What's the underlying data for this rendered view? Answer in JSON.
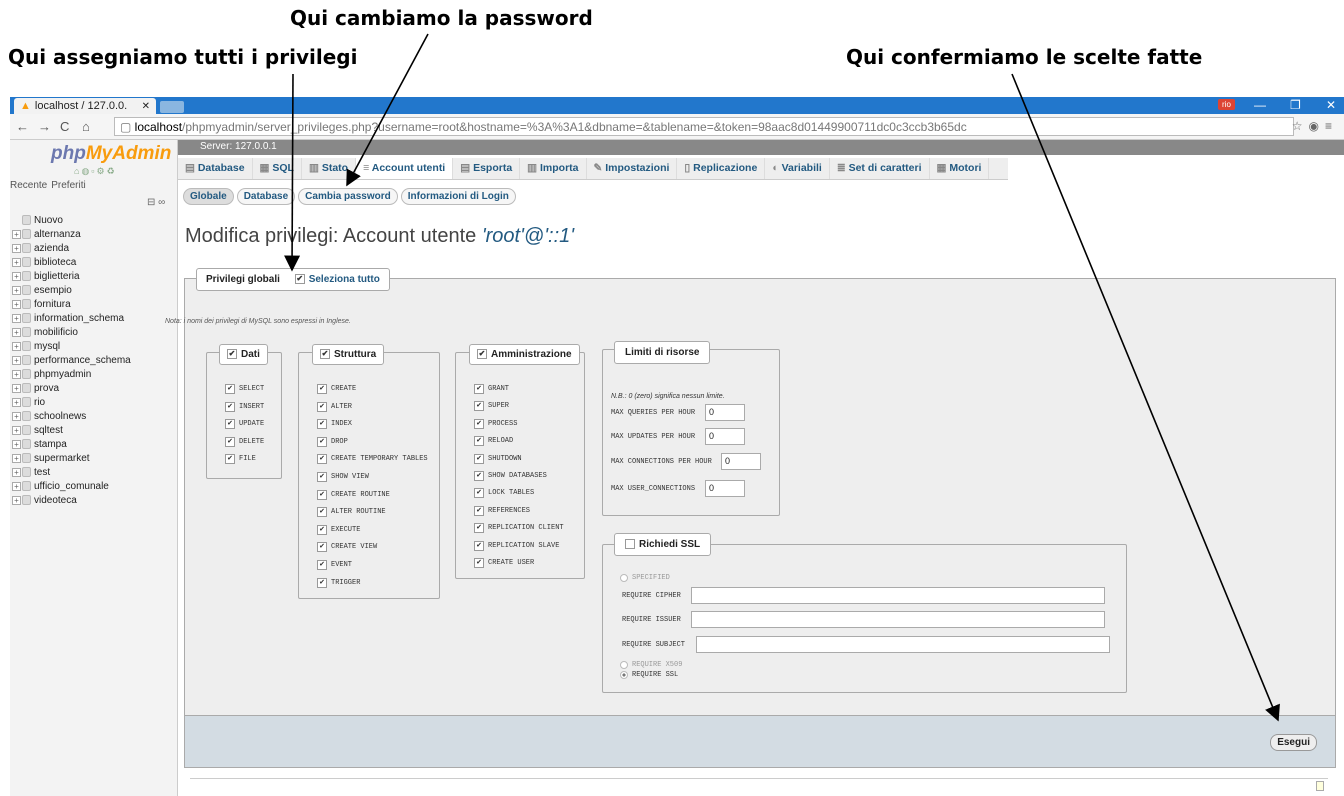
{
  "annotations": {
    "password": "Qui cambiamo la password",
    "privileges": "Qui assegniamo tutti i privilegi",
    "confirm": "Qui confermiamo le scelte fatte"
  },
  "browser": {
    "tab_title": "localhost / 127.0.0.",
    "url_host": "localhost",
    "url_rest": "/phpmyadmin/server_privileges.php?username=root&hostname=%3A%3A1&dbname=&tablename=&token=98aac8d01449900711dc0c3ccb3b65dc",
    "profile": "rio"
  },
  "sidebar": {
    "logo_a": "php",
    "logo_b": "MyAdmin",
    "recent": "Recente",
    "favorites": "Preferiti",
    "new": "Nuovo",
    "databases": [
      "alternanza",
      "azienda",
      "biblioteca",
      "biglietteria",
      "esempio",
      "fornitura",
      "information_schema",
      "mobilificio",
      "mysql",
      "performance_schema",
      "phpmyadmin",
      "prova",
      "rio",
      "schoolnews",
      "sqltest",
      "stampa",
      "supermarket",
      "test",
      "ufficio_comunale",
      "videoteca"
    ]
  },
  "server": "Server: 127.0.0.1",
  "menu": [
    "Database",
    "SQL",
    "Stato",
    "Account utenti",
    "Esporta",
    "Importa",
    "Impostazioni",
    "Replicazione",
    "Variabili",
    "Set di caratteri",
    "Motori"
  ],
  "subtabs": [
    "Globale",
    "Database",
    "Cambia password",
    "Informazioni di Login"
  ],
  "page": {
    "title": "Modifica privilegi: Account utente ",
    "user": "'root'@'::1'"
  },
  "global": {
    "legend": "Privilegi globali",
    "select_all": "Seleziona tutto"
  },
  "note": "Nota: i nomi dei privilegi di MySQL sono espressi in Inglese.",
  "groups": {
    "data": {
      "title": "Dati",
      "items": [
        "SELECT",
        "INSERT",
        "UPDATE",
        "DELETE",
        "FILE"
      ]
    },
    "structure": {
      "title": "Struttura",
      "items": [
        "CREATE",
        "ALTER",
        "INDEX",
        "DROP",
        "CREATE TEMPORARY TABLES",
        "SHOW VIEW",
        "CREATE ROUTINE",
        "ALTER ROUTINE",
        "EXECUTE",
        "CREATE VIEW",
        "EVENT",
        "TRIGGER"
      ]
    },
    "admin": {
      "title": "Amministrazione",
      "items": [
        "GRANT",
        "SUPER",
        "PROCESS",
        "RELOAD",
        "SHUTDOWN",
        "SHOW DATABASES",
        "LOCK TABLES",
        "REFERENCES",
        "REPLICATION CLIENT",
        "REPLICATION SLAVE",
        "CREATE USER"
      ]
    }
  },
  "limits": {
    "title": "Limiti di risorse",
    "note": "N.B.: 0 (zero) significa nessun limite.",
    "rows": [
      {
        "label": "MAX QUERIES PER HOUR",
        "value": "0"
      },
      {
        "label": "MAX UPDATES PER HOUR",
        "value": "0"
      },
      {
        "label": "MAX CONNECTIONS PER HOUR",
        "value": "0"
      },
      {
        "label": "MAX USER_CONNECTIONS",
        "value": "0"
      }
    ]
  },
  "ssl": {
    "title": "Richiedi SSL",
    "specified": "SPECIFIED",
    "cipher": "REQUIRE CIPHER",
    "issuer": "REQUIRE ISSUER",
    "subject": "REQUIRE SUBJECT",
    "x509": "REQUIRE X509",
    "ssl": "REQUIRE SSL"
  },
  "go_button": "Esegui"
}
